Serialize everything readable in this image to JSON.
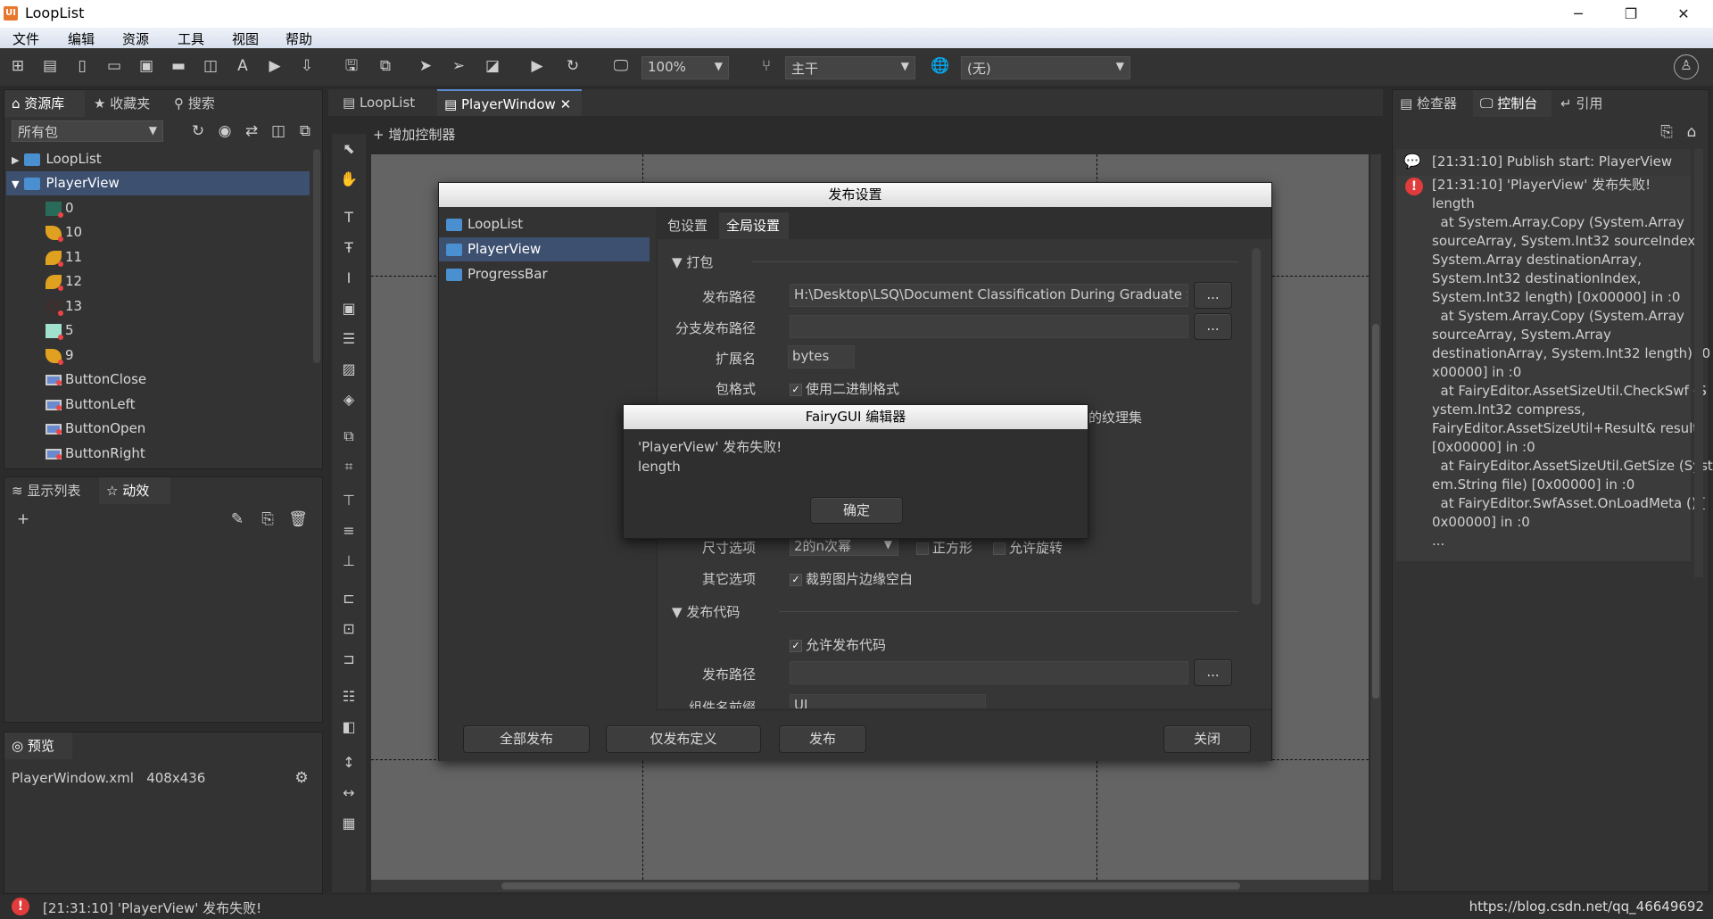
{
  "window": {
    "title": "LoopList",
    "app_icon": "UI"
  },
  "menu": [
    "文件",
    "编辑",
    "资源",
    "工具",
    "视图",
    "帮助"
  ],
  "toolbar": {
    "zoom": "100%",
    "branch": "主干",
    "language": "(无)"
  },
  "left_panel": {
    "tabs": [
      "资源库",
      "收藏夹",
      "搜索"
    ],
    "package_filter": "所有包",
    "tree": [
      {
        "label": "LoopList",
        "type": "package",
        "expanded": false
      },
      {
        "label": "PlayerView",
        "type": "package",
        "expanded": true,
        "selected": true
      },
      {
        "label": "0",
        "type": "image"
      },
      {
        "label": "10",
        "type": "image"
      },
      {
        "label": "11",
        "type": "image"
      },
      {
        "label": "12",
        "type": "image"
      },
      {
        "label": "13",
        "type": "image"
      },
      {
        "label": "5",
        "type": "image"
      },
      {
        "label": "9",
        "type": "image"
      },
      {
        "label": "ButtonClose",
        "type": "button"
      },
      {
        "label": "ButtonLeft",
        "type": "button"
      },
      {
        "label": "ButtonOpen",
        "type": "button"
      },
      {
        "label": "ButtonRight",
        "type": "button"
      }
    ],
    "bottom_tabs": [
      "显示列表",
      "动效"
    ],
    "preview": {
      "tab": "预览",
      "file": "PlayerWindow.xml",
      "size": "408x436"
    }
  },
  "doc_tabs": [
    "LoopList",
    "PlayerWindow"
  ],
  "add_controller": "增加控制器",
  "right_panel": {
    "tabs": [
      "检查器",
      "控制台",
      "引用"
    ],
    "console": [
      {
        "kind": "info",
        "text": "[21:31:10] Publish start: PlayerView"
      },
      {
        "kind": "error",
        "lines": [
          "[21:31:10] 'PlayerView' 发布失败!",
          "length",
          "  at System.Array.Copy (System.Array",
          "sourceArray, System.Int32 sourceIndex,",
          "System.Array destinationArray,",
          "System.Int32 destinationIndex,",
          "System.Int32 length) [0x00000] in :0",
          "  at System.Array.Copy (System.Array",
          "sourceArray, System.Array",
          "destinationArray, System.Int32 length) [0",
          "x00000] in :0",
          "  at FairyEditor.AssetSizeUtil.CheckSwf (S",
          "ystem.Int32 compress,",
          "FairyEditor.AssetSizeUtil+Result& result)",
          "[0x00000] in :0",
          "  at FairyEditor.AssetSizeUtil.GetSize (Syst",
          "em.String file) [0x00000] in :0",
          "  at FairyEditor.SwfAsset.OnLoadMeta () [",
          "0x00000] in :0",
          "..."
        ]
      }
    ]
  },
  "publish_dialog": {
    "title": "发布设置",
    "packages": [
      "LoopList",
      "PlayerView",
      "ProgressBar"
    ],
    "tabs": [
      "包设置",
      "全局设置"
    ],
    "section_pack": "打包",
    "publish_path_label": "发布路径",
    "publish_path": "H:\\Desktop\\LSQ\\Document Classification During Graduate Scho",
    "branch_path_label": "分支发布路径",
    "branch_path": "",
    "ext_label": "扩展名",
    "ext": "bytes",
    "format_label": "包格式",
    "binary_format": "使用二进制格式",
    "atlas_suffix": "的纹理集",
    "size_label": "尺寸选项",
    "size_value": "2的n次幂",
    "square": "正方形",
    "rotate": "允许旋转",
    "other_label": "其它选项",
    "trim": "裁剪图片边缘空白",
    "section_code": "发布代码",
    "allow_code": "允许发布代码",
    "code_path_label": "发布路径",
    "code_path": "",
    "prefix_label": "组件名前缀",
    "prefix": "UI",
    "browse": "...",
    "buttons": {
      "publish_all": "全部发布",
      "publish_def": "仅发布定义",
      "publish": "发布",
      "close": "关闭"
    }
  },
  "alert": {
    "title": "FairyGUI 编辑器",
    "message": "'PlayerView' 发布失败!",
    "detail": "length",
    "ok": "确定"
  },
  "status_bar": {
    "message": "[21:31:10] 'PlayerView' 发布失败!",
    "watermark": "https://blog.csdn.net/qq_46649692"
  }
}
